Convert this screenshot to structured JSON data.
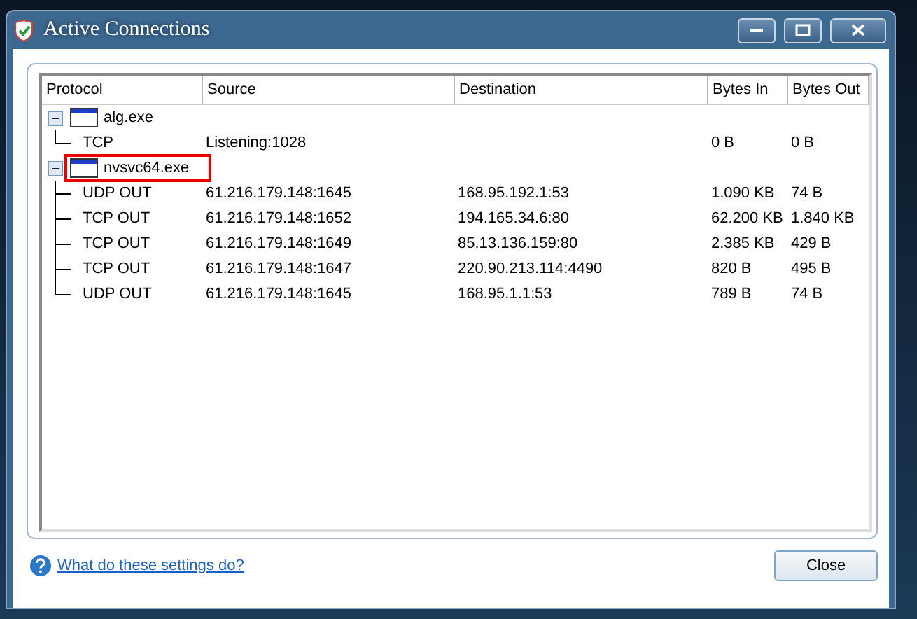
{
  "window": {
    "title": "Active Connections"
  },
  "table": {
    "columns": [
      "Protocol",
      "Source",
      "Destination",
      "Bytes In",
      "Bytes Out"
    ],
    "processes": [
      {
        "name": "alg.exe",
        "expanded": true,
        "highlighted": false,
        "children": [
          {
            "protocol": "TCP",
            "source": "Listening:1028",
            "bytes_in": "0 B",
            "bytes_out": "0 B"
          }
        ]
      },
      {
        "name": "nvsvc64.exe",
        "expanded": true,
        "highlighted": true,
        "children": [
          {
            "protocol": "UDP OUT",
            "source": "61.216.179.148:1645",
            "destination": "168.95.192.1:53",
            "bytes_in": "1.090 KB",
            "bytes_out": "74 B"
          },
          {
            "protocol": "TCP OUT",
            "source": "61.216.179.148:1652",
            "destination": "194.165.34.6:80",
            "bytes_in": "62.200 KB",
            "bytes_out": "1.840 KB"
          },
          {
            "protocol": "TCP OUT",
            "source": "61.216.179.148:1649",
            "destination": "85.13.136.159:80",
            "bytes_in": "2.385 KB",
            "bytes_out": "429 B"
          },
          {
            "protocol": "TCP OUT",
            "source": "61.216.179.148:1647",
            "destination": "220.90.213.114:4490",
            "bytes_in": "820 B",
            "bytes_out": "495 B"
          },
          {
            "protocol": "UDP OUT",
            "source": "61.216.179.148:1645",
            "destination": "168.95.1.1:53",
            "bytes_in": "789 B",
            "bytes_out": "74 B"
          }
        ]
      }
    ]
  },
  "help_link": "What do these settings do?",
  "buttons": [
    "Close"
  ]
}
